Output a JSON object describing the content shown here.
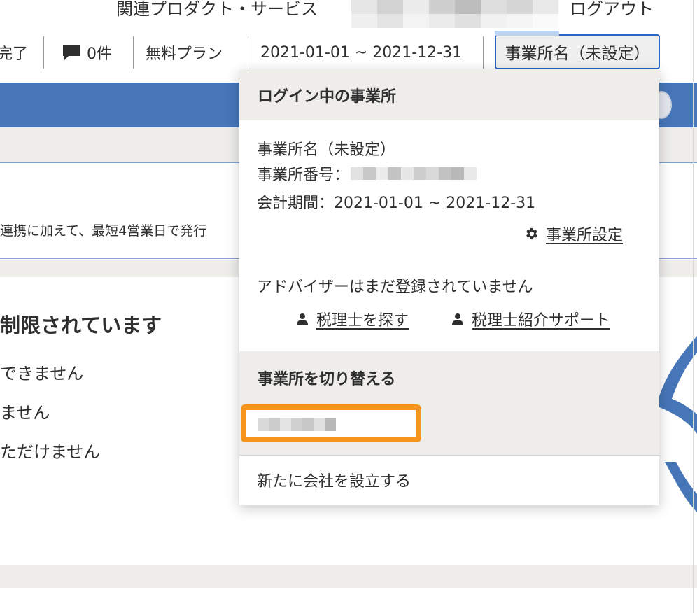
{
  "toplinks": {
    "related": "関連プロダクト・サービス",
    "logout": "ログアウト"
  },
  "toolbar": {
    "done_label": "完了",
    "messages_count": "0件",
    "plan": "無料プラン",
    "period": "2021-01-01 ~ 2021-12-31",
    "office_name": "事業所名（未設定）"
  },
  "page": {
    "notice_text": "連携に加えて、最短4営業日で発行",
    "heading": "制限されています",
    "line1": "できません",
    "line2": "ません",
    "line3": "ただけません"
  },
  "dropdown": {
    "login_header": "ログイン中の事業所",
    "office_name": "事業所名（未設定）",
    "office_number_label": "事業所番号：",
    "period": "会計期間：2021-01-01 ~ 2021-12-31",
    "settings_link": "事業所設定",
    "advisor_text": "アドバイザーはまだ登録されていません",
    "find_accountant_link": "税理士を探す",
    "accountant_support_link": "税理士紹介サポート",
    "switch_header": "事業所を切り替える",
    "new_company_link": "新たに会社を設立する"
  },
  "colors": {
    "accent_blue": "#4676b8",
    "focus_blue": "#2b66c4",
    "highlight_orange": "#f7941d",
    "panel_grey": "#eeedea"
  },
  "icons": {
    "message": "chat-bubble-icon",
    "settings": "gear-icon",
    "person": "person-icon"
  }
}
